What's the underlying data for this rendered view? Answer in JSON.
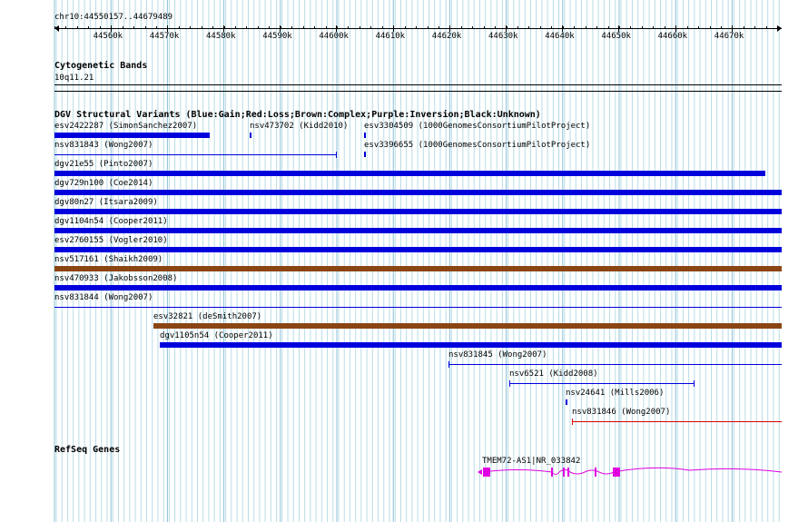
{
  "ruler": {
    "position": "chr10:44550157..44679489",
    "ticks": [
      "44560k",
      "44570k",
      "44580k",
      "44590k",
      "44600k",
      "44610k",
      "44620k",
      "44630k",
      "44640k",
      "44650k",
      "44660k",
      "44670k"
    ]
  },
  "cyto": {
    "title": "Cytogenetic Bands",
    "band": "10q11.21"
  },
  "dgv": {
    "title": "DGV Structural Variants (Blue:Gain;Red:Loss;Brown:Complex;Purple:Inversion;Black:Unknown)",
    "colors": {
      "gain": "#0000dd",
      "loss": "#dd0000",
      "complex": "#8b4513"
    },
    "variants": [
      {
        "label": "esv2422287 (SimonSanchez2007)",
        "type": "gain"
      },
      {
        "label": "nsv473702 (Kidd2010)",
        "type": "gain"
      },
      {
        "label": "esv3304509 (1000GenomesConsortiumPilotProject)",
        "type": "gain"
      },
      {
        "label": "nsv831843 (Wong2007)",
        "type": "gain"
      },
      {
        "label": "esv3396655 (1000GenomesConsortiumPilotProject)",
        "type": "gain"
      },
      {
        "label": "dgv21e55 (Pinto2007)",
        "type": "gain"
      },
      {
        "label": "dgv729n100 (Coe2014)",
        "type": "gain"
      },
      {
        "label": "dgv80n27 (Itsara2009)",
        "type": "gain"
      },
      {
        "label": "dgv1104n54 (Cooper2011)",
        "type": "gain"
      },
      {
        "label": "esv2760155 (Vogler2010)",
        "type": "gain"
      },
      {
        "label": "nsv517161 (Shaikh2009)",
        "type": "complex"
      },
      {
        "label": "nsv470933 (Jakobsson2008)",
        "type": "gain"
      },
      {
        "label": "nsv831844 (Wong2007)",
        "type": "gain"
      },
      {
        "label": "esv32821 (deSmith2007)",
        "type": "complex"
      },
      {
        "label": "dgv1105n54 (Cooper2011)",
        "type": "gain"
      },
      {
        "label": "nsv831845 (Wong2007)",
        "type": "gain"
      },
      {
        "label": "nsv6521 (Kidd2008)",
        "type": "gain"
      },
      {
        "label": "nsv24641 (Mills2006)",
        "type": "gain"
      },
      {
        "label": "nsv831846 (Wong2007)",
        "type": "loss"
      }
    ]
  },
  "refseq": {
    "title": "RefSeq Genes",
    "gene_label": "TMEM72-AS1|NR_033842",
    "gene_color": "#e000e0"
  }
}
